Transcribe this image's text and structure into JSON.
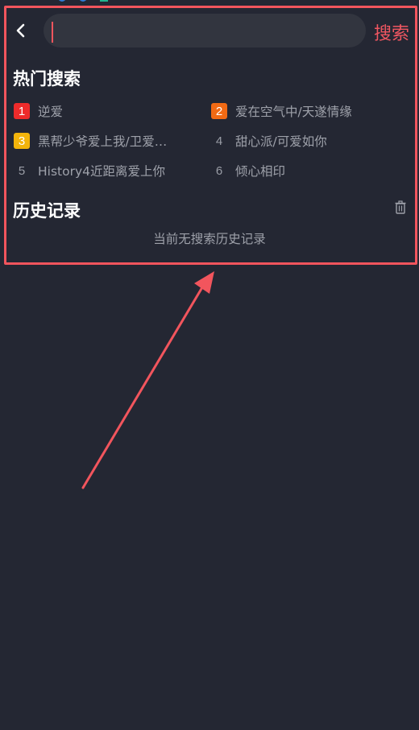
{
  "header": {
    "search": {
      "value": "",
      "placeholder": ""
    },
    "search_button_label": "搜索"
  },
  "hot_search": {
    "title": "热门搜索",
    "items": [
      {
        "rank": "1",
        "label": "逆爱",
        "badge_color": "#ee2b2b"
      },
      {
        "rank": "2",
        "label": "爱在空气中/天遂情缘",
        "badge_color": "#f26a14"
      },
      {
        "rank": "3",
        "label": "黑帮少爷爱上我/卫爱…",
        "badge_color": "#f3b40b"
      },
      {
        "rank": "4",
        "label": "甜心派/可爱如你",
        "badge_color": ""
      },
      {
        "rank": "5",
        "label": "History4近距离爱上你",
        "badge_color": ""
      },
      {
        "rank": "6",
        "label": "倾心相印",
        "badge_color": ""
      }
    ]
  },
  "history": {
    "title": "历史记录",
    "empty_text": "当前无搜索历史记录"
  },
  "colors": {
    "background": "#242733",
    "accent": "#ef5661",
    "annotation": "#f2555d"
  },
  "icons": [
    "back-arrow-icon",
    "trash-icon"
  ]
}
